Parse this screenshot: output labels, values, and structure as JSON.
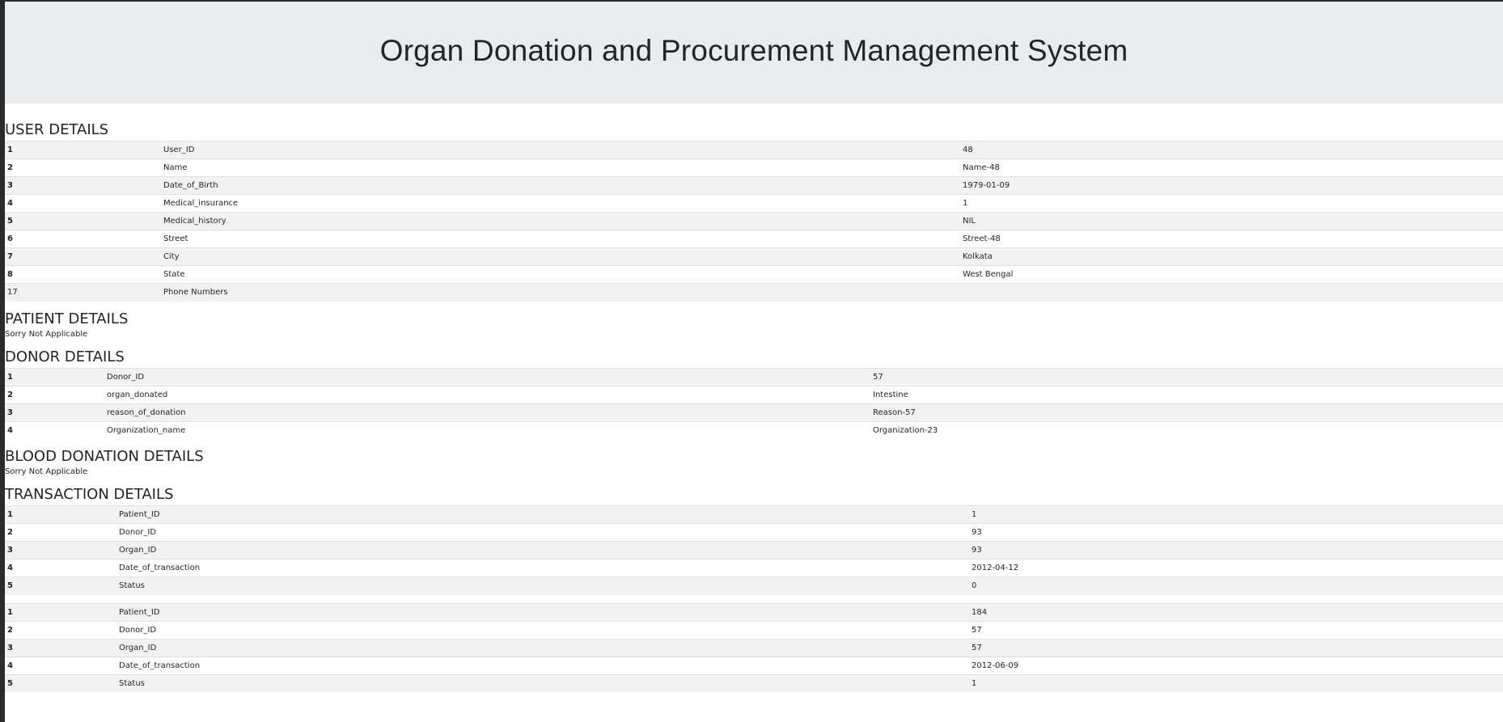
{
  "header": {
    "title": "Organ Donation and Procurement Management System"
  },
  "user_details": {
    "title": "USER DETAILS",
    "rows": [
      {
        "num": "1",
        "field": "User_ID",
        "value": "48"
      },
      {
        "num": "2",
        "field": "Name",
        "value": "Name-48"
      },
      {
        "num": "3",
        "field": "Date_of_Birth",
        "value": "1979-01-09"
      },
      {
        "num": "4",
        "field": "Medical_insurance",
        "value": "1"
      },
      {
        "num": "5",
        "field": "Medical_history",
        "value": "NIL"
      },
      {
        "num": "6",
        "field": "Street",
        "value": "Street-48"
      },
      {
        "num": "7",
        "field": "City",
        "value": "Kolkata"
      },
      {
        "num": "8",
        "field": "State",
        "value": "West Bengal"
      },
      {
        "num": "17",
        "field": "Phone Numbers",
        "value": ""
      }
    ]
  },
  "patient_details": {
    "title": "PATIENT DETAILS",
    "message": "Sorry Not Applicable"
  },
  "donor_details": {
    "title": "DONOR DETAILS",
    "rows": [
      {
        "num": "1",
        "field": "Donor_ID",
        "value": "57"
      },
      {
        "num": "2",
        "field": "organ_donated",
        "value": "Intestine"
      },
      {
        "num": "3",
        "field": "reason_of_donation",
        "value": "Reason-57"
      },
      {
        "num": "4",
        "field": "Organization_name",
        "value": "Organization-23"
      }
    ]
  },
  "blood_donation_details": {
    "title": "BLOOD DONATION DETAILS",
    "message": "Sorry Not Applicable"
  },
  "transaction_details": {
    "title": "TRANSACTION DETAILS",
    "transactions": [
      {
        "rows": [
          {
            "num": "1",
            "field": "Patient_ID",
            "value": "1"
          },
          {
            "num": "2",
            "field": "Donor_ID",
            "value": "93"
          },
          {
            "num": "3",
            "field": "Organ_ID",
            "value": "93"
          },
          {
            "num": "4",
            "field": "Date_of_transaction",
            "value": "2012-04-12"
          },
          {
            "num": "5",
            "field": "Status",
            "value": "0"
          }
        ]
      },
      {
        "rows": [
          {
            "num": "1",
            "field": "Patient_ID",
            "value": "184"
          },
          {
            "num": "2",
            "field": "Donor_ID",
            "value": "57"
          },
          {
            "num": "3",
            "field": "Organ_ID",
            "value": "57"
          },
          {
            "num": "4",
            "field": "Date_of_transaction",
            "value": "2012-06-09"
          },
          {
            "num": "5",
            "field": "Status",
            "value": "1"
          }
        ]
      }
    ]
  }
}
